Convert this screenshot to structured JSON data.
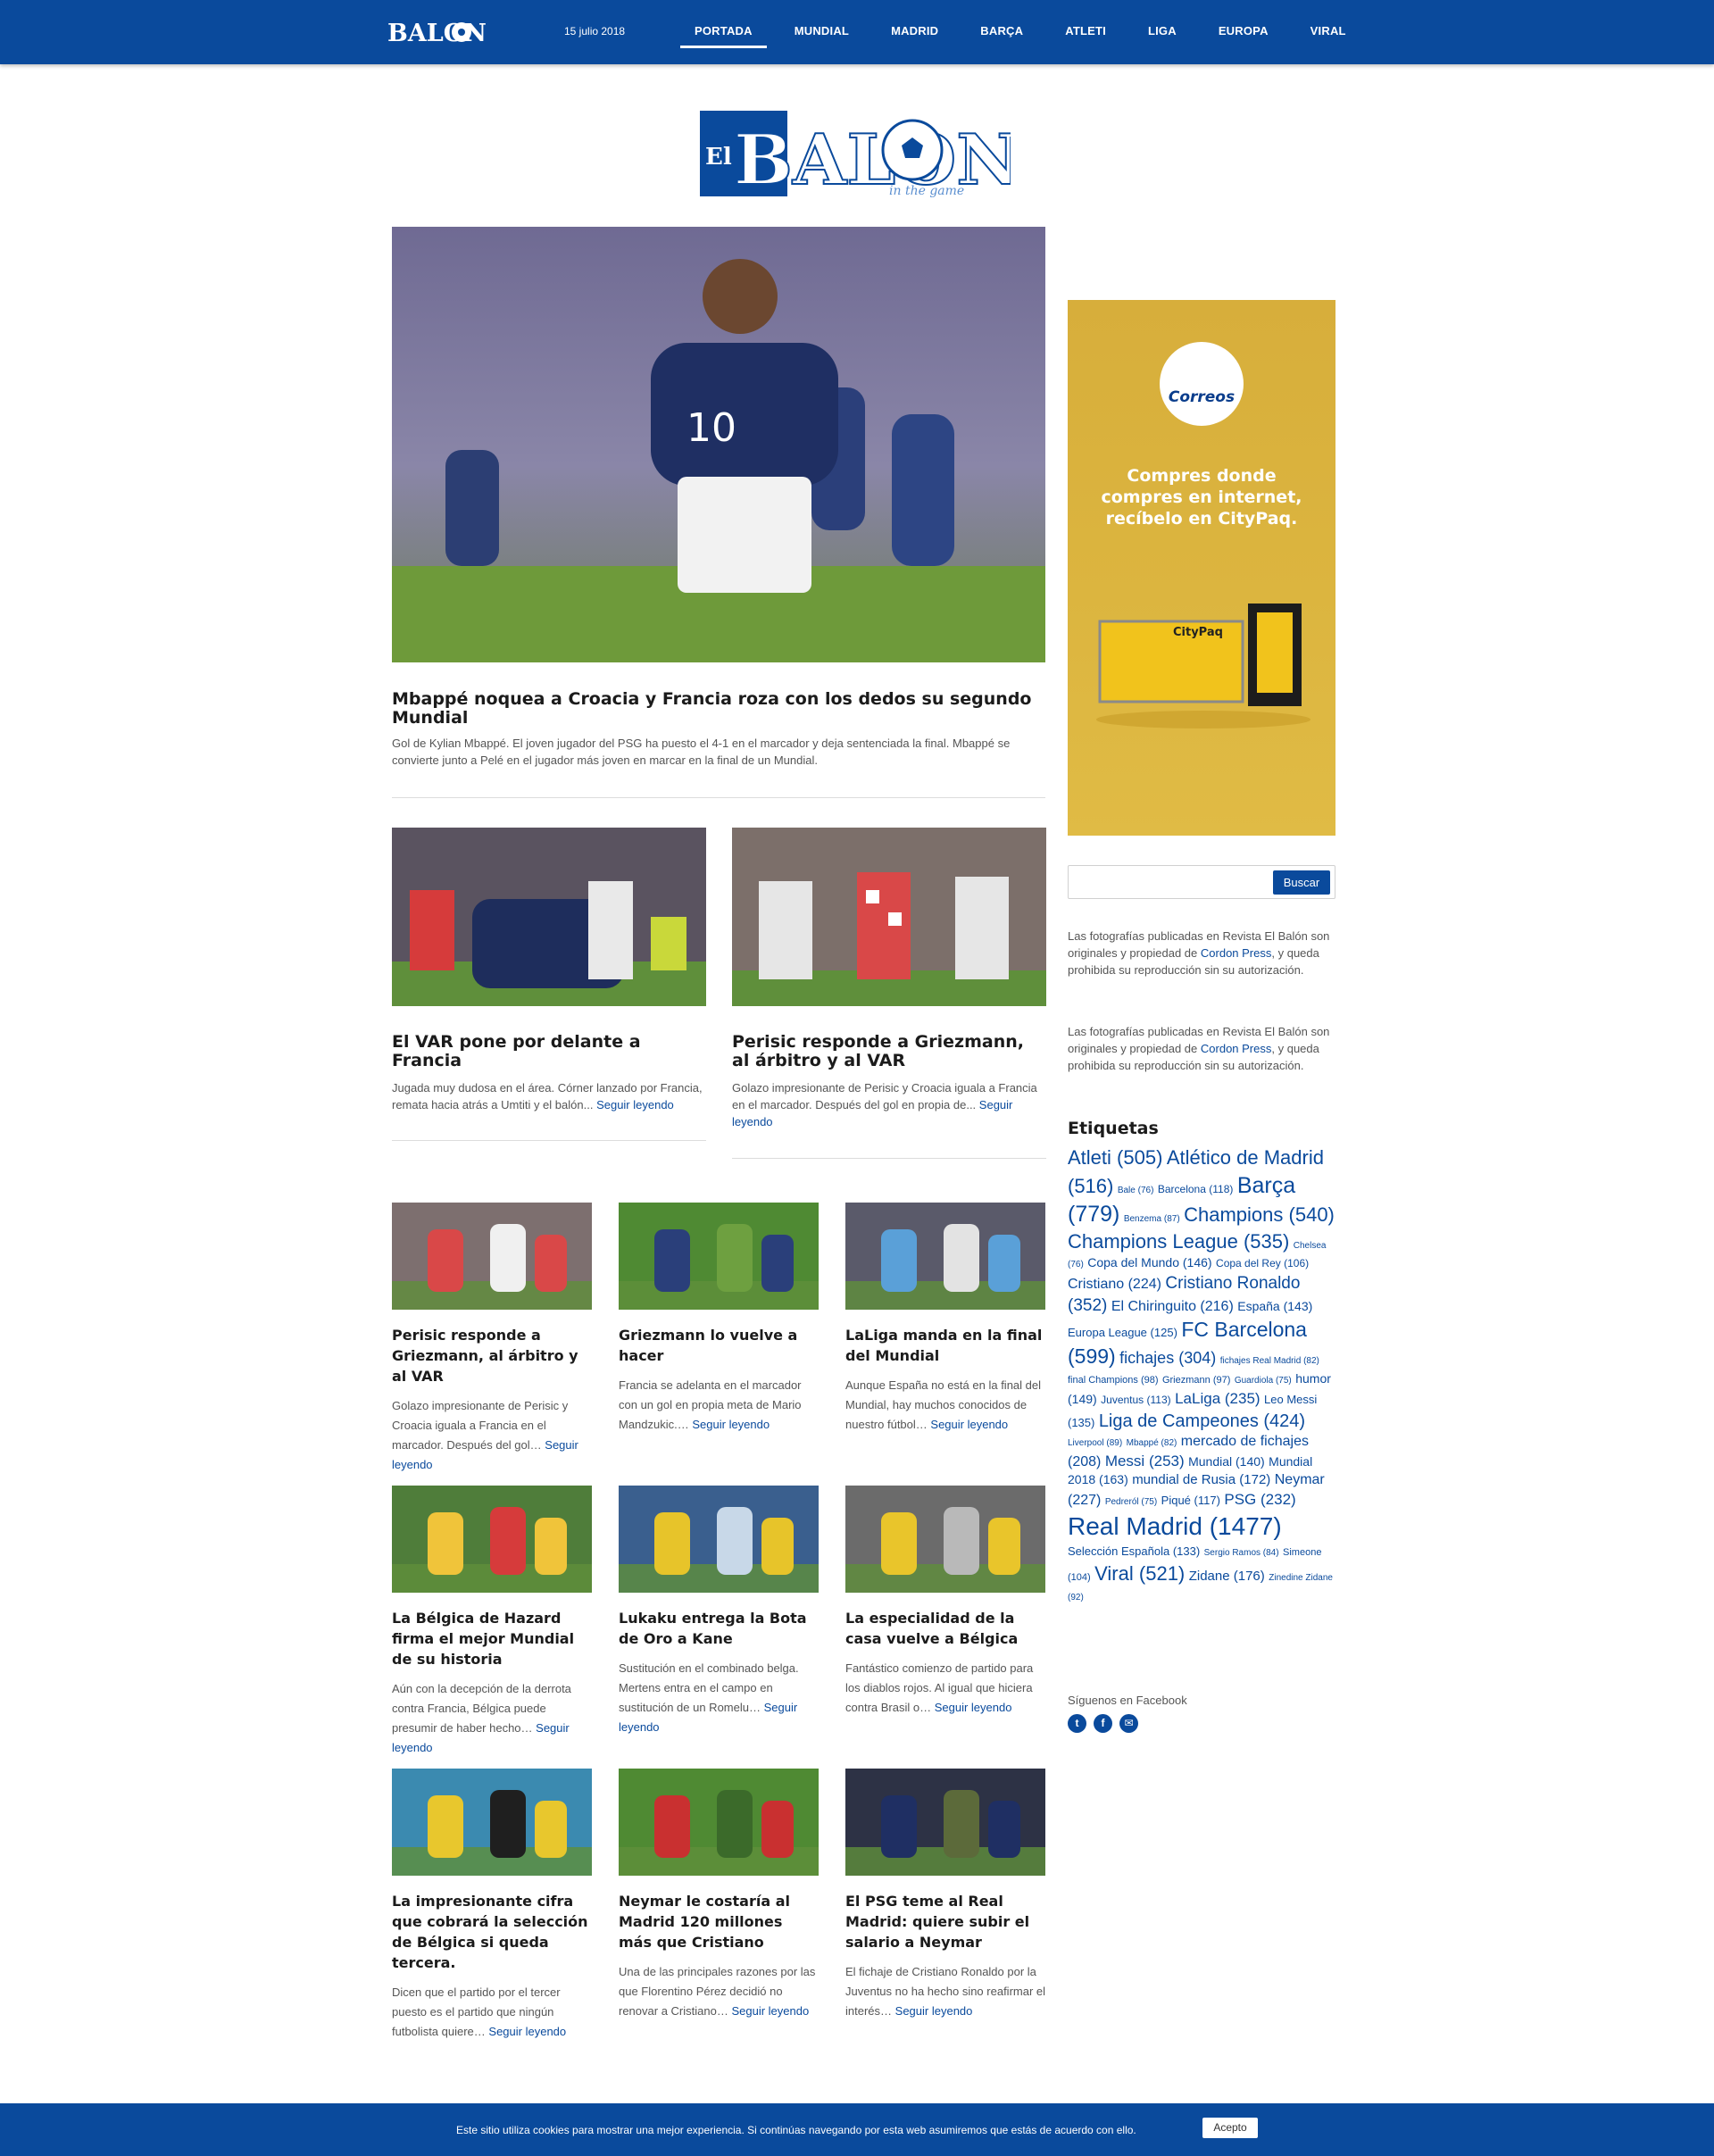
{
  "header": {
    "mini_logo": "BALON",
    "date": "15 julio 2018",
    "nav": [
      "PORTADA",
      "MUNDIAL",
      "MADRID",
      "BARÇA",
      "ATLETI",
      "LIGA",
      "EUROPA",
      "VIRAL"
    ],
    "active": "PORTADA"
  },
  "logo": {
    "el": "El",
    "balon": "BALON",
    "tagline": "in the game"
  },
  "hero": {
    "title": "Mbappé noquea a Croacia y Francia roza con los dedos su segundo Mundial",
    "excerpt": "Gol de Kylian Mbappé. El joven jugador del PSG ha puesto el 4-1 en el marcador y deja sentenciada la final. Mbappé se convierte junto a Pelé en el jugador más joven en marcar en la final de un Mundial."
  },
  "read_more": "Seguir leyendo",
  "featured": [
    {
      "title": "El VAR pone por delante a Francia",
      "excerpt": "Jugada muy dudosa en el área. Córner lanzado por Francia, remata hacia atrás a Umtiti y el balón..."
    },
    {
      "title": "Perisic responde a Griezmann, al árbitro y al VAR",
      "excerpt": "Golazo impresionante de Perisic y Croacia iguala a Francia en el marcador. Después del gol en propia de..."
    }
  ],
  "grid": [
    {
      "title": "Perisic responde a Griezmann, al árbitro y al VAR",
      "excerpt": "Golazo impresionante de Perisic y Croacia iguala a Francia en el marcador. Después del gol…"
    },
    {
      "title": "Griezmann lo vuelve a hacer",
      "excerpt": "Francia se adelanta en el marcador con un gol en propia meta de Mario Mandzukic.…"
    },
    {
      "title": "LaLiga manda en la final del Mundial",
      "excerpt": "Aunque España no está en la final del Mundial, hay muchos conocidos de nuestro fútbol…"
    },
    {
      "title": "La Bélgica de Hazard firma el mejor Mundial de su historia",
      "excerpt": "Aún con la decepción de la derrota contra Francia, Bélgica puede presumir de haber hecho…"
    },
    {
      "title": "Lukaku entrega la Bota de Oro a Kane",
      "excerpt": "Sustitución en el combinado belga. Mertens entra en el campo en sustitución de un Romelu…"
    },
    {
      "title": "La especialidad de la casa vuelve a Bélgica",
      "excerpt": "Fantástico comienzo de partido para los diablos rojos. Al igual que hiciera contra Brasil o…"
    },
    {
      "title": "La impresionante cifra que cobrará la selección de Bélgica si queda tercera.",
      "excerpt": "Dicen que el partido por el tercer puesto es el partido que ningún futbolista quiere…"
    },
    {
      "title": "Neymar le costaría al Madrid 120 millones más que Cristiano",
      "excerpt": "Una de las principales razones por las que Florentino Pérez decidió no renovar a Cristiano…"
    },
    {
      "title": "El PSG teme al Real Madrid: quiere subir el salario a Neymar",
      "excerpt": "El fichaje de Cristiano Ronaldo por la Juventus no ha hecho sino reafirmar el interés…"
    }
  ],
  "ad": {
    "brand": "Correos",
    "text": "Compres donde compres en internet, recíbelo en CityPaq.",
    "product": "CityPaq"
  },
  "search": {
    "placeholder": "",
    "button": "Buscar"
  },
  "credit": {
    "pre": "Las fotografías publicadas en Revista El Balón son originales y propiedad de ",
    "link": "Cordon Press",
    "post": ", y queda prohibida su reproducción sin su autorización."
  },
  "tags_title": "Etiquetas",
  "tags": [
    {
      "name": "Atleti",
      "count": "(505)",
      "size": 22
    },
    {
      "name": "Atlético de Madrid",
      "count": "(516)",
      "size": 22
    },
    {
      "name": "Bale",
      "count": "(76)",
      "size": 10
    },
    {
      "name": "Barcelona",
      "count": "(118)",
      "size": 12
    },
    {
      "name": "Barça",
      "count": "(779)",
      "size": 25
    },
    {
      "name": "Benzema",
      "count": "(87)",
      "size": 10
    },
    {
      "name": "Champions",
      "count": "(540)",
      "size": 22
    },
    {
      "name": "Champions League",
      "count": "(535)",
      "size": 22
    },
    {
      "name": "Chelsea",
      "count": "(76)",
      "size": 10
    },
    {
      "name": "Copa del Mundo",
      "count": "(146)",
      "size": 14
    },
    {
      "name": "Copa del Rey",
      "count": "(106)",
      "size": 12
    },
    {
      "name": "Cristiano",
      "count": "(224)",
      "size": 16
    },
    {
      "name": "Cristiano Ronaldo",
      "count": "(352)",
      "size": 19
    },
    {
      "name": "El Chiringuito",
      "count": "(216)",
      "size": 16
    },
    {
      "name": "España",
      "count": "(143)",
      "size": 14
    },
    {
      "name": "Europa League",
      "count": "(125)",
      "size": 13
    },
    {
      "name": "FC Barcelona",
      "count": "(599)",
      "size": 23
    },
    {
      "name": "fichajes",
      "count": "(304)",
      "size": 18
    },
    {
      "name": "fichajes Real Madrid",
      "count": "(82)",
      "size": 10
    },
    {
      "name": "final Champions",
      "count": "(98)",
      "size": 11
    },
    {
      "name": "Griezmann",
      "count": "(97)",
      "size": 11
    },
    {
      "name": "Guardiola",
      "count": "(75)",
      "size": 10
    },
    {
      "name": "humor",
      "count": "(149)",
      "size": 14
    },
    {
      "name": "Juventus",
      "count": "(113)",
      "size": 12
    },
    {
      "name": "LaLiga",
      "count": "(235)",
      "size": 17
    },
    {
      "name": "Leo Messi",
      "count": "(135)",
      "size": 13
    },
    {
      "name": "Liga de Campeones",
      "count": "(424)",
      "size": 20
    },
    {
      "name": "Liverpool",
      "count": "(89)",
      "size": 10
    },
    {
      "name": "Mbappé",
      "count": "(82)",
      "size": 10
    },
    {
      "name": "mercado de fichajes",
      "count": "(208)",
      "size": 16
    },
    {
      "name": "Messi",
      "count": "(253)",
      "size": 17
    },
    {
      "name": "Mundial",
      "count": "(140)",
      "size": 14
    },
    {
      "name": "Mundial 2018",
      "count": "(163)",
      "size": 14
    },
    {
      "name": "mundial de Rusia",
      "count": "(172)",
      "size": 15
    },
    {
      "name": "Neymar",
      "count": "(227)",
      "size": 16
    },
    {
      "name": "Pedreról",
      "count": "(75)",
      "size": 10
    },
    {
      "name": "Piqué",
      "count": "(117)",
      "size": 13
    },
    {
      "name": "PSG",
      "count": "(232)",
      "size": 17
    },
    {
      "name": "Real Madrid",
      "count": "(1477)",
      "size": 28
    },
    {
      "name": "Selección Española",
      "count": "(133)",
      "size": 13
    },
    {
      "name": "Sergio Ramos",
      "count": "(84)",
      "size": 10
    },
    {
      "name": "Simeone",
      "count": "(104)",
      "size": 11
    },
    {
      "name": "Viral",
      "count": "(521)",
      "size": 22
    },
    {
      "name": "Zidane",
      "count": "(176)",
      "size": 15
    },
    {
      "name": "Zinedine Zidane",
      "count": "(92)",
      "size": 10
    }
  ],
  "follow": "Síguenos en Facebook",
  "social": [
    "twitter-icon",
    "facebook-icon",
    "email-icon"
  ],
  "cookie": {
    "text": "Este sitio utiliza cookies para mostrar una mejor experiencia. Si continúas navegando por esta web asumiremos que estás de acuerdo con ello.",
    "button": "Acepto"
  },
  "colors": {
    "brand": "#0a4a9c",
    "ad": "#dcb53f"
  }
}
